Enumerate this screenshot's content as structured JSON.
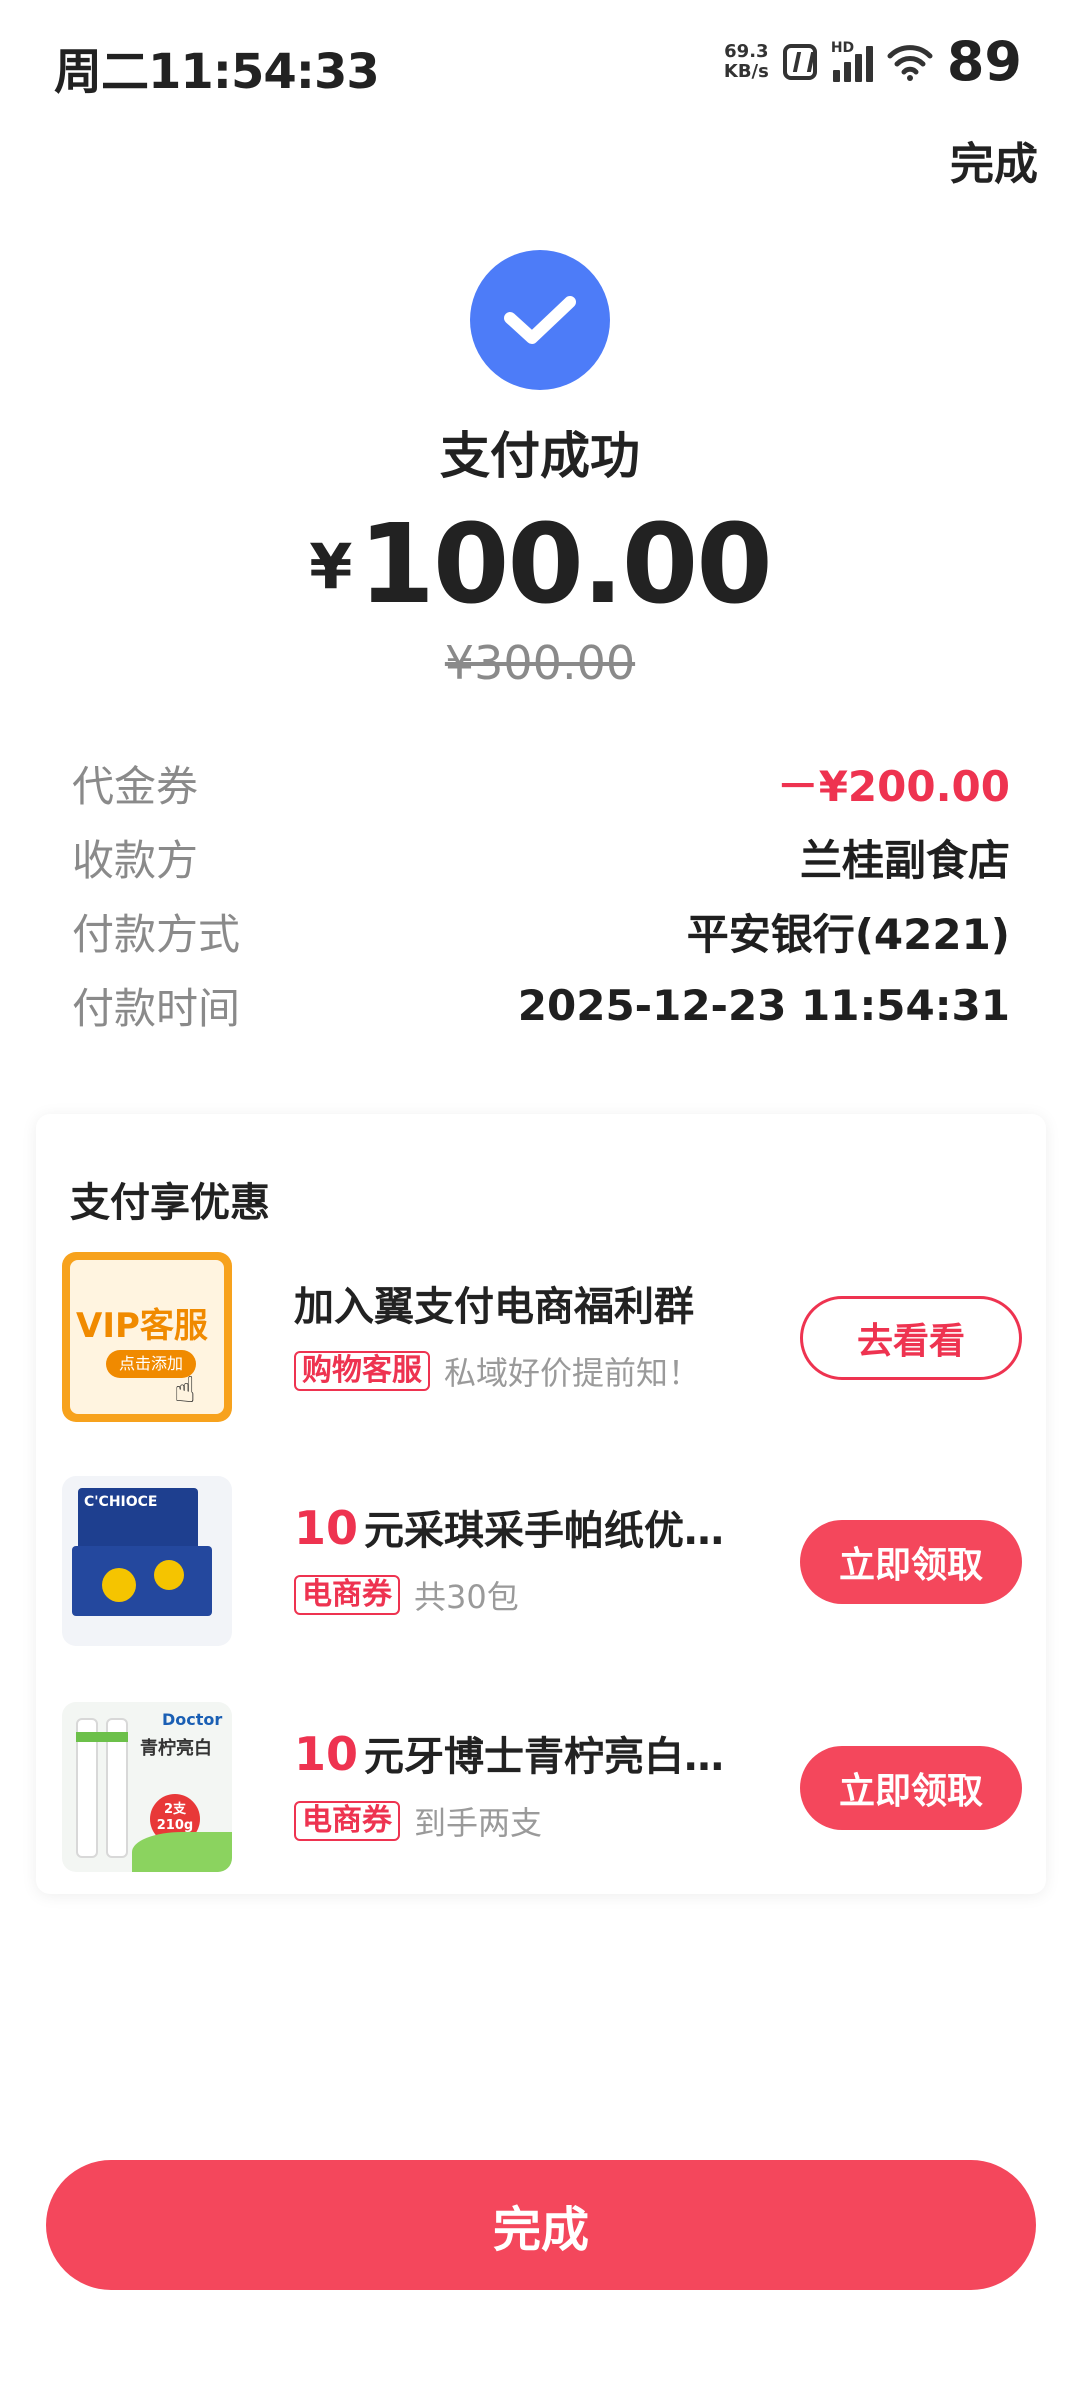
{
  "status_bar": {
    "time": "周二11:54:33",
    "net_speed_value": "69.3",
    "net_speed_unit": "KB/s",
    "signal_label": "HD",
    "battery": "89"
  },
  "header": {
    "done_label": "完成"
  },
  "result": {
    "title": "支付成功",
    "currency": "¥",
    "amount": "100.00",
    "original_amount": "¥300.00"
  },
  "details": [
    {
      "label": "代金券",
      "value": "－¥200.00",
      "highlight": true
    },
    {
      "label": "收款方",
      "value": "兰桂副食店",
      "highlight": false
    },
    {
      "label": "付款方式",
      "value": "平安银行(4221)",
      "highlight": false
    },
    {
      "label": "付款时间",
      "value": "2025-12-23 11:54:31",
      "highlight": false
    }
  ],
  "promo": {
    "title": "支付享优惠",
    "items": [
      {
        "name_prefix": "",
        "name": "加入翼支付电商福利群",
        "tag": "购物客服",
        "desc": "私域好价提前知！",
        "button": "去看看",
        "thumb_text": "VIP客服",
        "thumb_sub": "点击添加"
      },
      {
        "name_prefix": "10",
        "name": "元采琪采手帕纸优惠券",
        "tag": "电商券",
        "desc": "共30包",
        "button": "立即领取",
        "thumb_text": "C'CHIOCE"
      },
      {
        "name_prefix": "10",
        "name": "元牙博士青柠亮白牙…",
        "tag": "电商券",
        "desc": "到手两支",
        "button": "立即领取",
        "thumb_text": "青柠亮白",
        "thumb_brand": "Doctor",
        "thumb_badge": "2支 210g"
      }
    ]
  },
  "footer": {
    "done_label": "完成"
  },
  "colors": {
    "accent_red": "#f4475c",
    "check_blue": "#4d7cf8"
  }
}
